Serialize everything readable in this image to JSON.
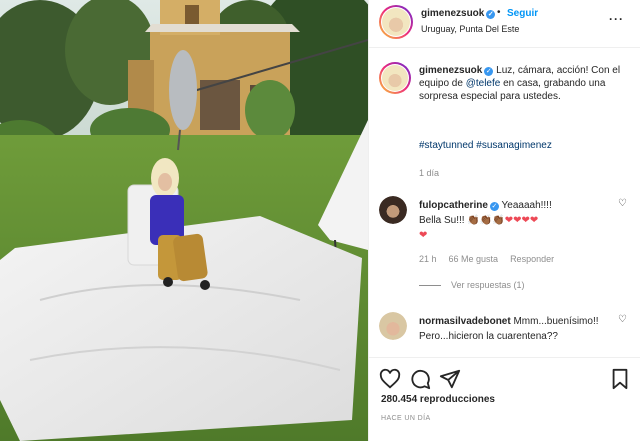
{
  "post": {
    "username": "gimenezsuok",
    "follow_label": "Seguir",
    "separator": "•",
    "location": "Uruguay, Punta Del Este",
    "more_icon": "more-icon"
  },
  "caption": {
    "username": "gimenezsuok",
    "text_before": " Luz, cámara, acción! Con el equipo de ",
    "mention": "@telefe",
    "text_after": " en casa, grabando una sorpresa especial para ustedes.",
    "hashtags": "#staytunned #susanagimenez",
    "age": "1 día"
  },
  "comments": [
    {
      "username": "fulopcatherine",
      "text_line1": " Yeaaaah!!!!",
      "text_line2": "Bella Su!!! ",
      "emoji_hands": "👏🏾👏🏾👏🏾",
      "emoji_hearts": "❤❤❤❤",
      "emoji_heart_end": "❤",
      "age": "21 h",
      "likes": "66 Me gusta",
      "reply_label": "Responder",
      "view_replies": "Ver respuestas (1)"
    },
    {
      "username": "normasilvadebonet",
      "text": " Mmm...buenísimo!! Pero...hicieron la cuarentena??"
    }
  ],
  "footer": {
    "views": "280.454 reproducciones",
    "timestamp": "HACE UN DÍA"
  },
  "colors": {
    "link_blue": "#0095f6",
    "verified_blue": "#3897f0",
    "hashtag": "#00376b",
    "muted": "#8e8e8e",
    "heart_red": "#ed4956"
  }
}
